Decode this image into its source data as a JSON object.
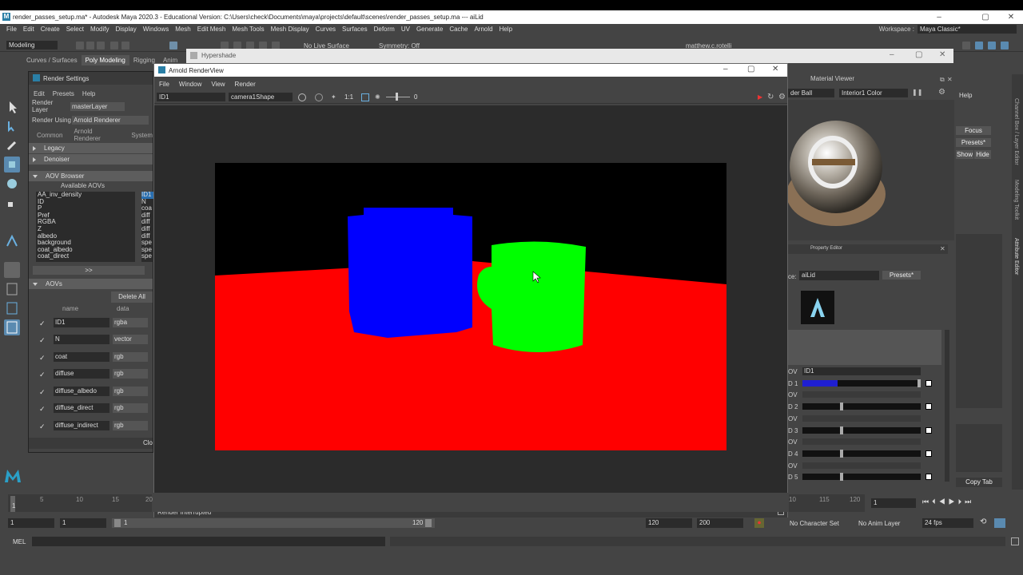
{
  "window": {
    "title": "render_passes_setup.ma* - Autodesk Maya 2020.3 - Educational Version: C:\\Users\\check\\Documents\\maya\\projects\\default\\scenes\\render_passes_setup.ma  ---  aiLid"
  },
  "menubar": [
    "File",
    "Edit",
    "Create",
    "Select",
    "Modify",
    "Display",
    "Windows",
    "Mesh",
    "Edit Mesh",
    "Mesh Tools",
    "Mesh Display",
    "Curves",
    "Surfaces",
    "Deform",
    "UV",
    "Generate",
    "Cache",
    "Arnold",
    "Help"
  ],
  "workspace": {
    "label": "Workspace :",
    "value": "Maya Classic*"
  },
  "statusline": {
    "mode": "Modeling",
    "live_surface": "No Live Surface",
    "symmetry": "Symmetry: Off",
    "user": "matthew.c.rotelli"
  },
  "shelf_tabs": [
    "Curves / Surfaces",
    "Poly Modeling",
    "Rigging",
    "Anim"
  ],
  "hypershade": {
    "title": "Hypershade"
  },
  "render_settings": {
    "title": "Render Settings",
    "menu": [
      "Edit",
      "Presets",
      "Help"
    ],
    "render_layer_label": "Render Layer",
    "render_layer": "masterLayer",
    "render_using_label": "Render Using",
    "render_using": "Arnold Renderer",
    "tabs": [
      "Common",
      "Arnold Renderer",
      "System"
    ],
    "sections": {
      "legacy": "Legacy",
      "denoiser": "Denoiser",
      "aov_browser": "AOV Browser",
      "aovs": "AOVs"
    },
    "available_aovs_label": "Available AOVs",
    "available_aovs": [
      "AA_inv_density",
      "ID",
      "P",
      "Pref",
      "RGBA",
      "Z",
      "albedo",
      "background",
      "coat_albedo",
      "coat_direct"
    ],
    "active_aovs_col": [
      "ID1",
      "N",
      "coa",
      "diff",
      "diff",
      "diff",
      "diff",
      "spe",
      "spe",
      "spe"
    ],
    "move_button": ">>",
    "delete_all": "Delete All",
    "col_name": "name",
    "col_data": "data",
    "aovs": [
      {
        "name": "ID1",
        "data": "rgba"
      },
      {
        "name": "N",
        "data": "vector"
      },
      {
        "name": "coat",
        "data": "rgb"
      },
      {
        "name": "diffuse",
        "data": "rgb"
      },
      {
        "name": "diffuse_albedo",
        "data": "rgb"
      },
      {
        "name": "diffuse_direct",
        "data": "rgb"
      },
      {
        "name": "diffuse_indirect",
        "data": "rgb"
      }
    ],
    "close": "Clo"
  },
  "renderview": {
    "title": "Arnold RenderView",
    "menu": [
      "File",
      "Window",
      "View",
      "Render"
    ],
    "aov": "ID1",
    "camera": "camera1Shape",
    "ratio": "1:1",
    "exposure": "0",
    "status": "Render Interrupted"
  },
  "material_viewer": {
    "title": "Material Viewer",
    "geometry": "der Ball",
    "env": "Interior1 Color"
  },
  "property_editor": {
    "title": "Property Editor",
    "ce_label": "ce:",
    "node": "aiLid",
    "presets": "Presets*"
  },
  "aov_sliders": [
    {
      "label": "OV",
      "value_text": "ID1",
      "kind": "text"
    },
    {
      "label": "D 1",
      "fill": 0.3,
      "kind": "slider"
    },
    {
      "label": "OV",
      "kind": "empty"
    },
    {
      "label": "D 2",
      "fill": 0.32,
      "kind": "slider"
    },
    {
      "label": "OV",
      "kind": "empty"
    },
    {
      "label": "D 3",
      "fill": 0.32,
      "kind": "slider"
    },
    {
      "label": "OV",
      "kind": "empty"
    },
    {
      "label": "D 4",
      "fill": 0.32,
      "kind": "slider"
    },
    {
      "label": "OV",
      "kind": "empty"
    },
    {
      "label": "D 5",
      "fill": 0.32,
      "kind": "slider"
    }
  ],
  "right_panel": {
    "help": "Help",
    "focus": "Focus",
    "presets": "Presets*",
    "show": "Show",
    "hide": "Hide",
    "copy_tab": "Copy Tab"
  },
  "vertical_tabs": [
    "Channel Box / Layer Editor",
    "Modeling Toolkit",
    "Attribute Editor"
  ],
  "timeline": {
    "current": "1",
    "ticks_left": [
      "5",
      "10",
      "15",
      "20"
    ],
    "ticks_right": [
      "10",
      "115",
      "120"
    ]
  },
  "range": {
    "start": "1",
    "start2": "1",
    "slider_start": "1",
    "slider_end": "120",
    "end": "120",
    "end2": "200",
    "character_set": "No Character Set",
    "anim_layer": "No Anim Layer",
    "fps": "24 fps"
  },
  "command_line": {
    "lang": "MEL"
  },
  "colors": {
    "id_red": "#ff0000",
    "id_blue": "#0000ff",
    "id_green": "#00ff00",
    "accent": "#2a7fa6"
  }
}
